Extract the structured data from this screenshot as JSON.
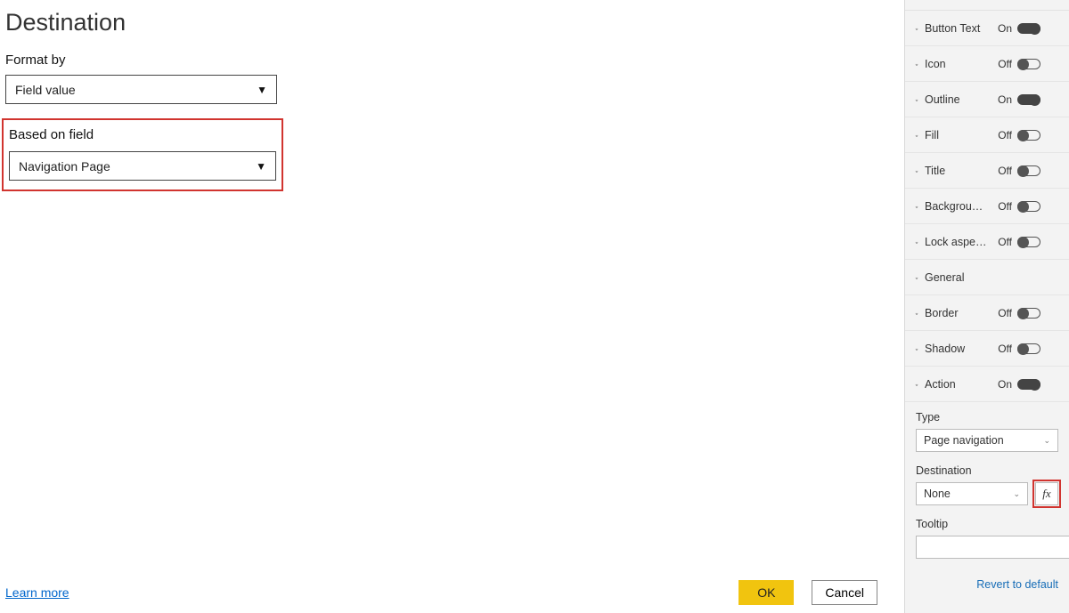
{
  "dialog": {
    "title": "Destination",
    "format_by_label": "Format by",
    "format_by_value": "Field value",
    "based_on_field_label": "Based on field",
    "based_on_field_value": "Navigation Page",
    "learn_more": "Learn more",
    "ok": "OK",
    "cancel": "Cancel"
  },
  "format_pane": {
    "sections": [
      {
        "label": "Button Text",
        "state": "On",
        "on": true
      },
      {
        "label": "Icon",
        "state": "Off",
        "on": false
      },
      {
        "label": "Outline",
        "state": "On",
        "on": true
      },
      {
        "label": "Fill",
        "state": "Off",
        "on": false
      },
      {
        "label": "Title",
        "state": "Off",
        "on": false
      },
      {
        "label": "Backgrou…",
        "state": "Off",
        "on": false
      },
      {
        "label": "Lock aspe…",
        "state": "Off",
        "on": false
      },
      {
        "label": "General",
        "state": "",
        "on": null
      },
      {
        "label": "Border",
        "state": "Off",
        "on": false
      },
      {
        "label": "Shadow",
        "state": "Off",
        "on": false
      },
      {
        "label": "Action",
        "state": "On",
        "on": true
      }
    ],
    "type_label": "Type",
    "type_value": "Page navigation",
    "destination_label": "Destination",
    "destination_value": "None",
    "tooltip_label": "Tooltip",
    "tooltip_value": "",
    "fx": "fx",
    "revert": "Revert to default"
  }
}
